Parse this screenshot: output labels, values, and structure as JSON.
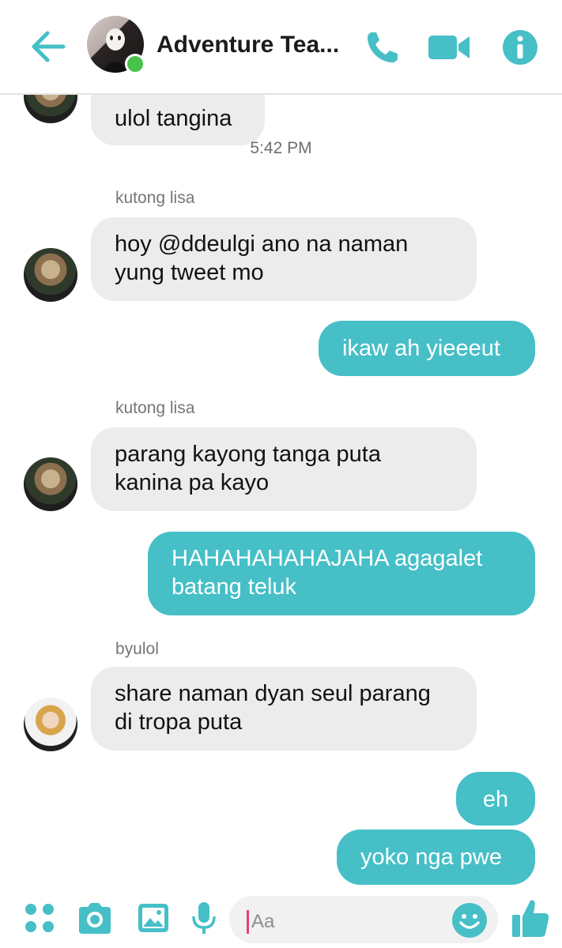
{
  "header": {
    "title": "Adventure Tea...",
    "accent": "#46bfc7",
    "online_color": "#48c24a",
    "icons": [
      "back-arrow-icon",
      "phone-icon",
      "video-camera-icon",
      "info-icon"
    ]
  },
  "messages": {
    "partial_top": "ulol tangina",
    "timestamp": "5:42 PM",
    "sender1": "kutong lisa",
    "msg1_line1": "hoy @ddeulgi ano na naman",
    "msg1_line2": "yung tweet mo",
    "out1": "ikaw ah yieeeut",
    "sender2": "kutong lisa",
    "msg2_line1": "parang kayong tanga puta",
    "msg2_line2": "kanina pa kayo",
    "out2_line1": "HAHAHAHAHAJAHA agagalet",
    "out2_line2": "batang teluk",
    "sender3": "byulol",
    "msg3_line1": "share naman dyan seul parang",
    "msg3_line2": "di tropa puta",
    "out3": "eh",
    "out4": "yoko nga pwe"
  },
  "composer": {
    "placeholder": "Aa",
    "icons": [
      "apps-icon",
      "camera-icon",
      "gallery-icon",
      "microphone-icon",
      "emoji-icon",
      "thumbs-up-icon"
    ]
  }
}
